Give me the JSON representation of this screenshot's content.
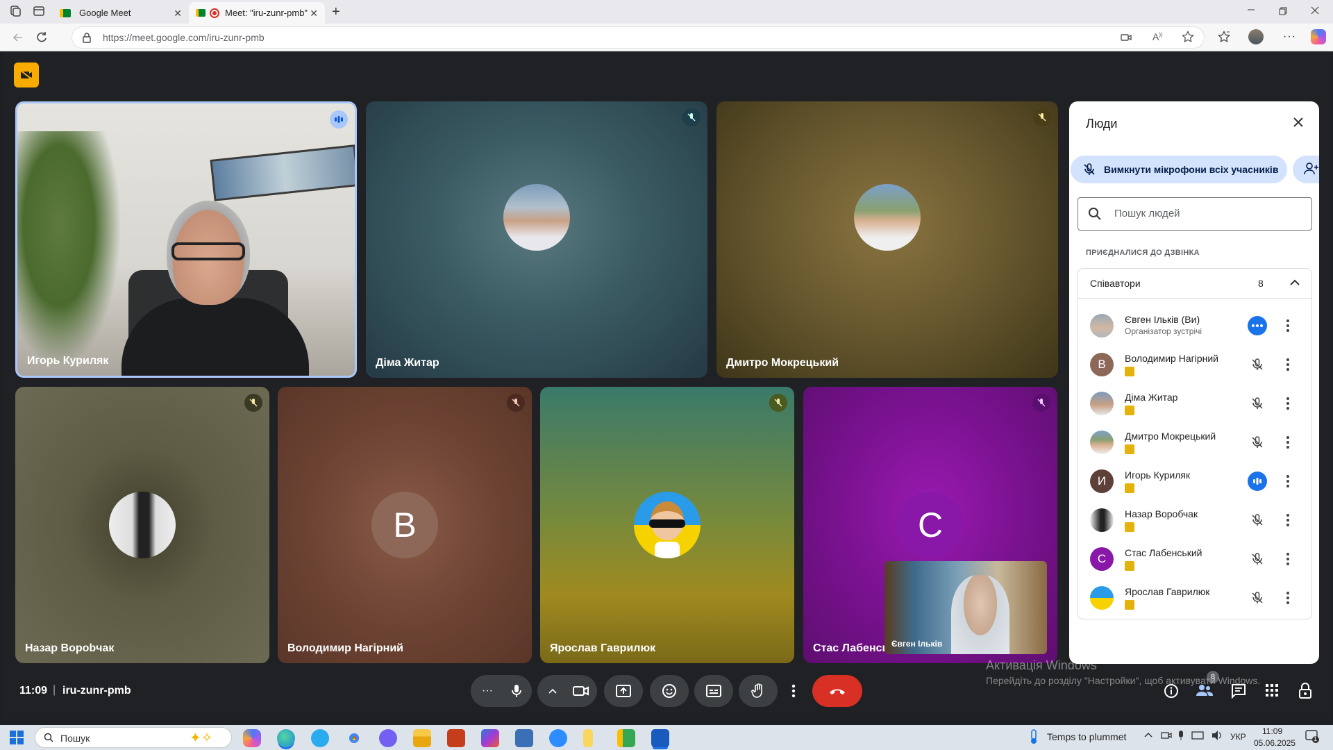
{
  "browser": {
    "tabs": [
      {
        "label": "Google Meet",
        "active": false
      },
      {
        "label": "Meet: \"iru-zunr-pmb\"",
        "active": true
      }
    ],
    "url": "https://meet.google.com/iru-zunr-pmb"
  },
  "meeting": {
    "time": "11:09",
    "separator": "|",
    "code": "iru-zunr-pmb",
    "people_count": "8"
  },
  "tiles": [
    {
      "name": "Игорь Куриляк",
      "speaking": true
    },
    {
      "name": "Діма Житар",
      "speaking": false
    },
    {
      "name": "Дмитро Мокрецький",
      "speaking": false
    },
    {
      "name": "Назар Ворobчак",
      "speaking": false
    },
    {
      "name": "Володимир Нагірний",
      "speaking": false,
      "letter": "B"
    },
    {
      "name": "Ярослав Гаврилюк",
      "speaking": false
    },
    {
      "name": "Стас Лабенськ",
      "speaking": false,
      "letter": "C"
    }
  ],
  "self_view": {
    "name": "Євген Ільків"
  },
  "panel": {
    "title": "Люди",
    "mute_all_label": "Вимкнути мікрофони всіх учасників",
    "search_placeholder": "Пошук людей",
    "section_label": "ПРИЄДНАЛИСЯ ДО ДЗВІНКА",
    "group_label": "Співавтори",
    "group_count": "8",
    "participants": [
      {
        "name": "Євген Ільків (Ви)",
        "sub": "Організатор зустрічі",
        "letter": "",
        "state": "more"
      },
      {
        "name": "Володимир Нагірний",
        "sub": "",
        "letter": "В",
        "state": "muted"
      },
      {
        "name": "Діма Житар",
        "sub": "",
        "letter": "",
        "state": "muted"
      },
      {
        "name": "Дмитро Мокрецький",
        "sub": "",
        "letter": "",
        "state": "muted"
      },
      {
        "name": "Игорь Куриляк",
        "sub": "",
        "letter": "И",
        "state": "speaking"
      },
      {
        "name": "Назар Воробчак",
        "sub": "",
        "letter": "",
        "state": "muted"
      },
      {
        "name": "Стас Лабенський",
        "sub": "",
        "letter": "C",
        "state": "muted"
      },
      {
        "name": "Ярослав Гаврилюк",
        "sub": "",
        "letter": "",
        "state": "muted"
      }
    ]
  },
  "watermark": {
    "title": "Активація Windows",
    "text": "Перейдіть до розділу \"Настройки\", щоб активувати Windows."
  },
  "taskbar": {
    "search": "Пошук",
    "weather": "Temps to plummet",
    "lang": "УКР",
    "time": "11:09",
    "date": "05.06.2025",
    "notif": "1"
  },
  "colors": {
    "end_call": "#d93025",
    "accent_blue": "#1a73e8",
    "panel_chip": "#d3e3fd",
    "badge_yellow": "#e3b30b"
  }
}
